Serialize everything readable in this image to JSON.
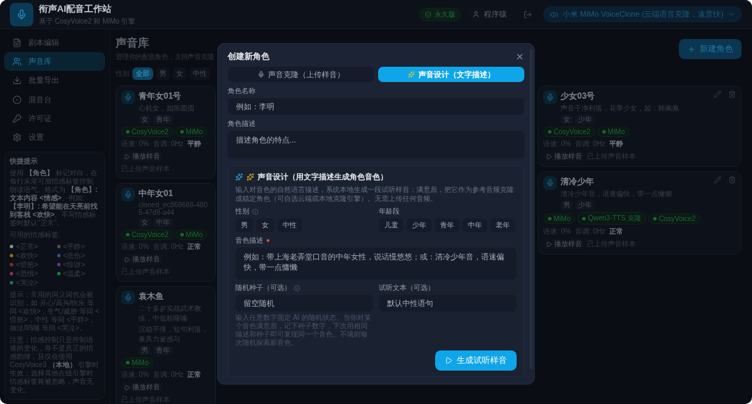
{
  "app": {
    "title": "衔声AI配音工作站",
    "subtitle": "基于 CosyVoice2 和 MiMo 引擎"
  },
  "header": {
    "license_badge": "永久版",
    "user": "程序猿",
    "engine_select": "小米 MiMo VoiceClone (云端语音克隆，速度快)"
  },
  "sidebar": {
    "items": [
      {
        "label": "剧本编辑",
        "selected": false
      },
      {
        "label": "声音库",
        "selected": true
      },
      {
        "label": "批量导出",
        "selected": false
      },
      {
        "label": "混音台",
        "selected": false
      },
      {
        "label": "许可证",
        "selected": false
      },
      {
        "label": "设置",
        "selected": false
      }
    ],
    "tips": {
      "title": "快捷提示",
      "intro": "使用 **【角色】** 标记对白，在每行末尾可加情感标签控制朗读语气。格式为 **【角色】: 文本内容 <情感>**。例如: **【李明】: 希望能在天亮前找到客栈 <欢快>**。不写情感标签时默认\"正常\"。",
      "emotions_label": "可用的情感标签:",
      "emotions": [
        {
          "label": "<正常>",
          "color": "#8a8f98"
        },
        {
          "label": "<平静>",
          "color": "#4b5059"
        },
        {
          "label": "<欢快>",
          "color": "#8a6d12"
        },
        {
          "label": "<悲伤>",
          "color": "#2f4f8a"
        },
        {
          "label": "<愤怒>",
          "color": "#8a2a2a"
        },
        {
          "label": "<惊讶>",
          "color": "#6a2f8a"
        },
        {
          "label": "<恐惧>",
          "color": "#8a2f55"
        },
        {
          "label": "<温柔>",
          "color": "#1f7a3a"
        },
        {
          "label": "<哭泣>",
          "color": "#1f6f6f"
        }
      ],
      "hint": "提示：常用的同义词也会被识别，如 开心/高兴/快乐 等同 <欢快>，生气/威胁 等同 <愤怒>，中性 等同 <平静>，抽泣/呜咽 等同 <哭泣>。",
      "note": "注意：情感控制只是控制语速的变化，并不是真正的情感韵律，且仅在使用 CosyVoice3 **（本地）** 引擎时生效；选择其他在线引擎时情感标签将被忽略，声音无变化。"
    }
  },
  "page": {
    "title": "声音库",
    "subtitle": "管理你的配音角色，支持声音克隆",
    "new_button": "新建角色",
    "filter": {
      "label": "性别",
      "options": [
        {
          "label": "全部",
          "selected": true
        },
        {
          "label": "男",
          "selected": false
        },
        {
          "label": "女",
          "selected": false
        },
        {
          "label": "中性",
          "selected": false
        }
      ]
    }
  },
  "voice_columns": [
    [
      {
        "name": "青年女01号",
        "description_lines": [
          "心机女，如陈圆圆"
        ],
        "tags": [
          "女",
          "青年"
        ],
        "engines": [
          "CosyVoice2",
          "MiMo"
        ],
        "speed": "语速: 0%",
        "pitch": "音调: 0Hz",
        "emotion": "平静",
        "play": "播放样音",
        "status": "已上传声音样本",
        "editable": false
      },
      {
        "name": "中年女01",
        "description_lines": [
          "cloned_ec868688-4805-47d9-a44"
        ],
        "tags": [
          "女",
          "中年"
        ],
        "engines": [
          "CosyVoice2",
          "MiMo"
        ],
        "speed": "语速: 0%",
        "pitch": "音调: 0Hz",
        "emotion": "正常",
        "play": "播放样音",
        "status": "已上传声音样本",
        "editable": false
      },
      {
        "name": "袁木鱼",
        "description_lines": [
          "二十多岁实战武术教练，中低粗哑嗓",
          "沉稳平缓，短句利落，兼具力量感与"
        ],
        "tags": [
          "男",
          "青年"
        ],
        "engines": [
          "MiMo"
        ],
        "speed": "语速: 0%",
        "pitch": "音调: 0Hz",
        "emotion": "正常",
        "play": "播放样音",
        "status": "已上传声音样本",
        "editable": false
      }
    ],
    [
      {
        "name": "少女03号",
        "description_lines": [
          "声音干净利落，花季少女，如：韩佩佩"
        ],
        "tags": [
          "女",
          "少年"
        ],
        "engines": [
          "CosyVoice2",
          "MiMo"
        ],
        "speed": "语速: 0%",
        "pitch": "音调: 0Hz",
        "emotion": "平静",
        "play": "播放样音",
        "status": "已上传声音样本",
        "editable": true
      },
      {
        "name": "清冷少年",
        "description_lines": [
          "清冷少年音，语速偏快，带一点慵懒"
        ],
        "tags": [
          "男",
          "少年"
        ],
        "engines": [
          "MiMo",
          "Qwen3-TTS 克隆",
          "CosyVoice2"
        ],
        "speed": "语速: 0%",
        "pitch": "音调: 0Hz",
        "emotion": "正常",
        "play": "播放样音",
        "status": "已上传声音样本",
        "editable": true
      }
    ]
  ],
  "modal": {
    "title": "创建新角色",
    "tabs": [
      {
        "label": "声音克隆（上传样音）",
        "selected": false
      },
      {
        "label": "声音设计（文字描述）",
        "selected": true
      }
    ],
    "name_field": {
      "label": "角色名称",
      "placeholder": "例如：李明"
    },
    "description_field": {
      "label": "角色描述",
      "placeholder": "描述角色的特点..."
    },
    "design": {
      "title": "声音设计（用文字描述生成角色音色）",
      "intro": "输入对音色的自然语言描述，系统本地生成一段试听样音；满意后，把它作为参考音频克隆成稳定角色（可自选云端或本地克隆引擎）。无需上传任何音频。",
      "gender": {
        "label": "性别",
        "options": [
          {
            "label": "男",
            "selected": false
          },
          {
            "label": "女",
            "selected": false
          },
          {
            "label": "中性",
            "selected": false
          }
        ]
      },
      "age": {
        "label": "年龄段",
        "options": [
          {
            "label": "儿童",
            "selected": false
          },
          {
            "label": "少年",
            "selected": false
          },
          {
            "label": "青年",
            "selected": false
          },
          {
            "label": "中年",
            "selected": false
          },
          {
            "label": "老年",
            "selected": false
          }
        ]
      },
      "timbre": {
        "label": "音色描述",
        "required": true,
        "placeholder": "例如：带上海老弄堂口音的中年女性，说话慢悠悠；或：清冷少年音，语速偏快，带一点慵懒"
      },
      "seed": {
        "label": "随机种子（可选）",
        "placeholder": "留空随机",
        "hint": "输入任意数字固定 AI 的随机状态。当你对某个音色满意后，记下种子数字，下次用相同描述和种子即可复现同一个音色。不填则每次随机探索新音色。"
      },
      "preview_text": {
        "label": "试听文本（可选）",
        "placeholder": "默认中性语句"
      },
      "generate_button": "生成试听样音"
    }
  }
}
